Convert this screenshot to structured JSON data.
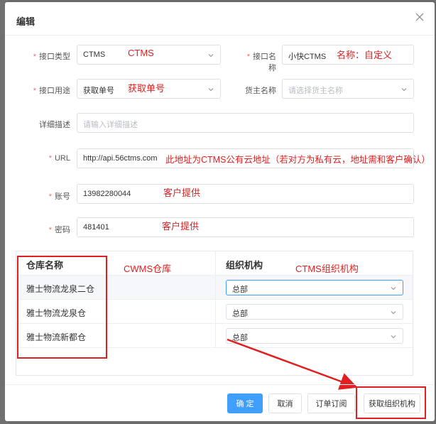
{
  "dialog": {
    "title": "编辑"
  },
  "form": {
    "interface_type": {
      "label": "接口类型",
      "value": "CTMS",
      "note": "CTMS"
    },
    "interface_name": {
      "label": "接口名称",
      "value": "小快CTMS",
      "note": "名称：自定义"
    },
    "interface_use": {
      "label": "接口用途",
      "value": "获取单号",
      "note": "获取单号"
    },
    "owner_name": {
      "label": "货主名称",
      "placeholder": "请选择货主名称"
    },
    "description": {
      "label": "详细描述",
      "placeholder": "请输入详细描述"
    },
    "url": {
      "label": "URL",
      "value": "http://api.56ctms.com",
      "note": "此地址为CTMS公有云地址（若对方为私有云，地址需和客户确认）"
    },
    "account": {
      "label": "账号",
      "value": "13982280044",
      "note": "客户提供"
    },
    "password": {
      "label": "密码",
      "value": "481401",
      "note": "客户提供"
    }
  },
  "table": {
    "col1_header": "仓库名称",
    "col1_note": "CWMS仓库",
    "col2_header": "组织机构",
    "col2_note": "CTMS组织机构",
    "rows": [
      {
        "warehouse": "雅士物流龙泉二仓",
        "org": "总部"
      },
      {
        "warehouse": "雅士物流龙泉仓",
        "org": "总部"
      },
      {
        "warehouse": "雅士物流新都仓",
        "org": "总部"
      }
    ]
  },
  "footer": {
    "confirm": "确 定",
    "cancel": "取消",
    "subscribe": "订单订阅",
    "fetch_org": "获取组织机构"
  },
  "colors": {
    "primary": "#409eff",
    "annotation": "#e02020",
    "required": "#f56c6c"
  }
}
